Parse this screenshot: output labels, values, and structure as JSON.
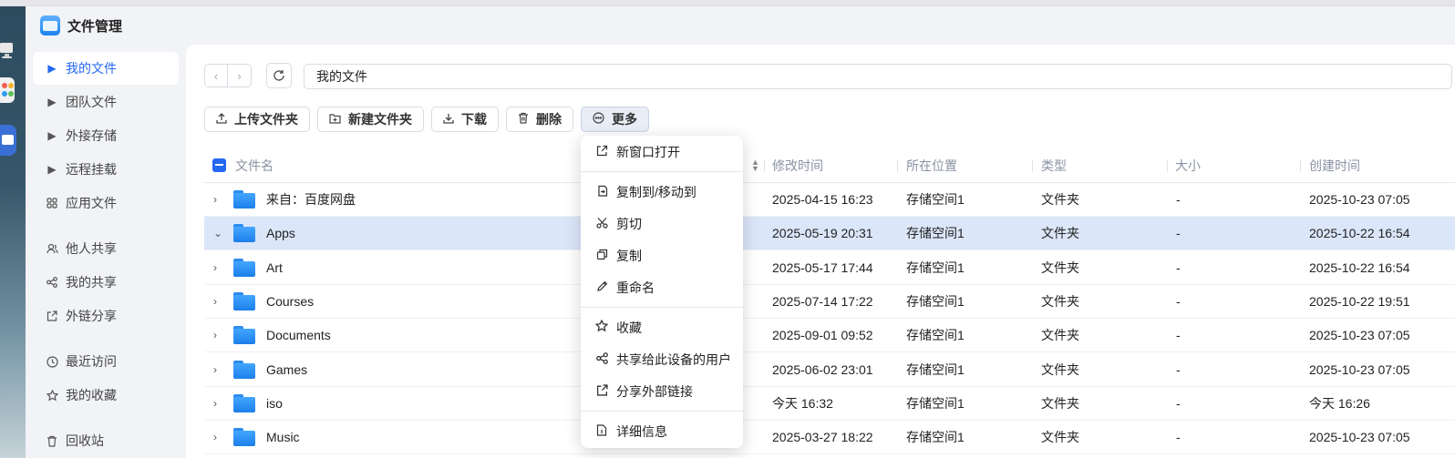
{
  "app": {
    "title": "文件管理"
  },
  "sidebar": {
    "items": [
      {
        "label": "我的文件",
        "icon": "caret-right-icon",
        "active": true
      },
      {
        "label": "团队文件",
        "icon": "caret-right-icon"
      },
      {
        "label": "外接存储",
        "icon": "caret-right-icon"
      },
      {
        "label": "远程挂载",
        "icon": "caret-right-icon"
      },
      {
        "label": "应用文件",
        "icon": "apps-grid-icon"
      },
      {
        "label": "他人共享",
        "icon": "users-icon"
      },
      {
        "label": "我的共享",
        "icon": "share-icon"
      },
      {
        "label": "外链分享",
        "icon": "external-share-icon"
      },
      {
        "label": "最近访问",
        "icon": "clock-icon"
      },
      {
        "label": "我的收藏",
        "icon": "star-icon"
      },
      {
        "label": "回收站",
        "icon": "trash-icon"
      }
    ]
  },
  "path": {
    "value": "我的文件"
  },
  "toolbar": {
    "upload_label": "上传文件夹",
    "new_folder_label": "新建文件夹",
    "download_label": "下载",
    "delete_label": "删除",
    "more_label": "更多"
  },
  "table": {
    "headers": {
      "name": "文件名",
      "modified": "修改时间",
      "location": "所在位置",
      "type": "类型",
      "size": "大小",
      "created": "创建时间"
    },
    "rows": [
      {
        "name": "来自：百度网盘",
        "modified": "2025-04-15 16:23",
        "location": "存储空间1",
        "type": "文件夹",
        "size": "-",
        "created": "2025-10-23 07:05"
      },
      {
        "name": "Apps",
        "modified": "2025-05-19 20:31",
        "location": "存储空间1",
        "type": "文件夹",
        "size": "-",
        "created": "2025-10-22 16:54",
        "selected": true
      },
      {
        "name": "Art",
        "modified": "2025-05-17 17:44",
        "location": "存储空间1",
        "type": "文件夹",
        "size": "-",
        "created": "2025-10-22 16:54"
      },
      {
        "name": "Courses",
        "modified": "2025-07-14 17:22",
        "location": "存储空间1",
        "type": "文件夹",
        "size": "-",
        "created": "2025-10-22 19:51"
      },
      {
        "name": "Documents",
        "modified": "2025-09-01 09:52",
        "location": "存储空间1",
        "type": "文件夹",
        "size": "-",
        "created": "2025-10-23 07:05"
      },
      {
        "name": "Games",
        "modified": "2025-06-02 23:01",
        "location": "存储空间1",
        "type": "文件夹",
        "size": "-",
        "created": "2025-10-23 07:05"
      },
      {
        "name": "iso",
        "modified": "今天 16:32",
        "location": "存储空间1",
        "type": "文件夹",
        "size": "-",
        "created": "今天 16:26"
      },
      {
        "name": "Music",
        "modified": "2025-03-27 18:22",
        "location": "存储空间1",
        "type": "文件夹",
        "size": "-",
        "created": "2025-10-23 07:05"
      }
    ]
  },
  "context_menu": {
    "open_new_window": "新窗口打开",
    "copy_move_to": "复制到/移动到",
    "cut": "剪切",
    "copy": "复制",
    "rename": "重命名",
    "favorite": "收藏",
    "share_device_users": "共享给此设备的用户",
    "share_external_link": "分享外部链接",
    "details": "详细信息"
  },
  "colors": {
    "accent": "#2468f2",
    "selected_row": "#dbe6f9",
    "folder": "#2c8cf0"
  }
}
